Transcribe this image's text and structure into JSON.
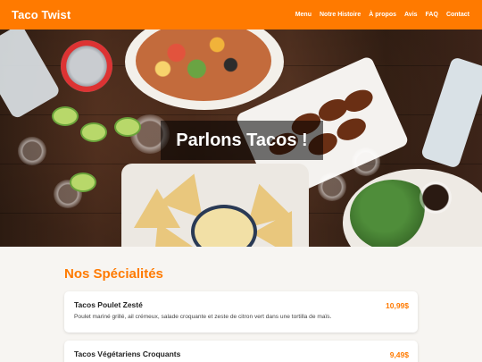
{
  "nav": {
    "brand": "Taco Twist",
    "links": [
      "Menu",
      "Notre Histoire",
      "À propos",
      "Avis",
      "FAQ",
      "Contact"
    ]
  },
  "hero": {
    "title": "Parlons Tacos !"
  },
  "specialties": {
    "title": "Nos Spécialités",
    "items": [
      {
        "name": "Tacos Poulet Zesté",
        "price": "10,99$",
        "description": "Poulet mariné grillé, ail crémeux, salade croquante et zeste de citron vert dans une tortilla de maïs."
      },
      {
        "name": "Tacos Végétariens Croquants",
        "price": "9,49$",
        "description": ""
      }
    ]
  },
  "colors": {
    "accent": "#ff7a00",
    "nav_bg": "#ff7a00",
    "page_bg": "#f7f5f2"
  }
}
